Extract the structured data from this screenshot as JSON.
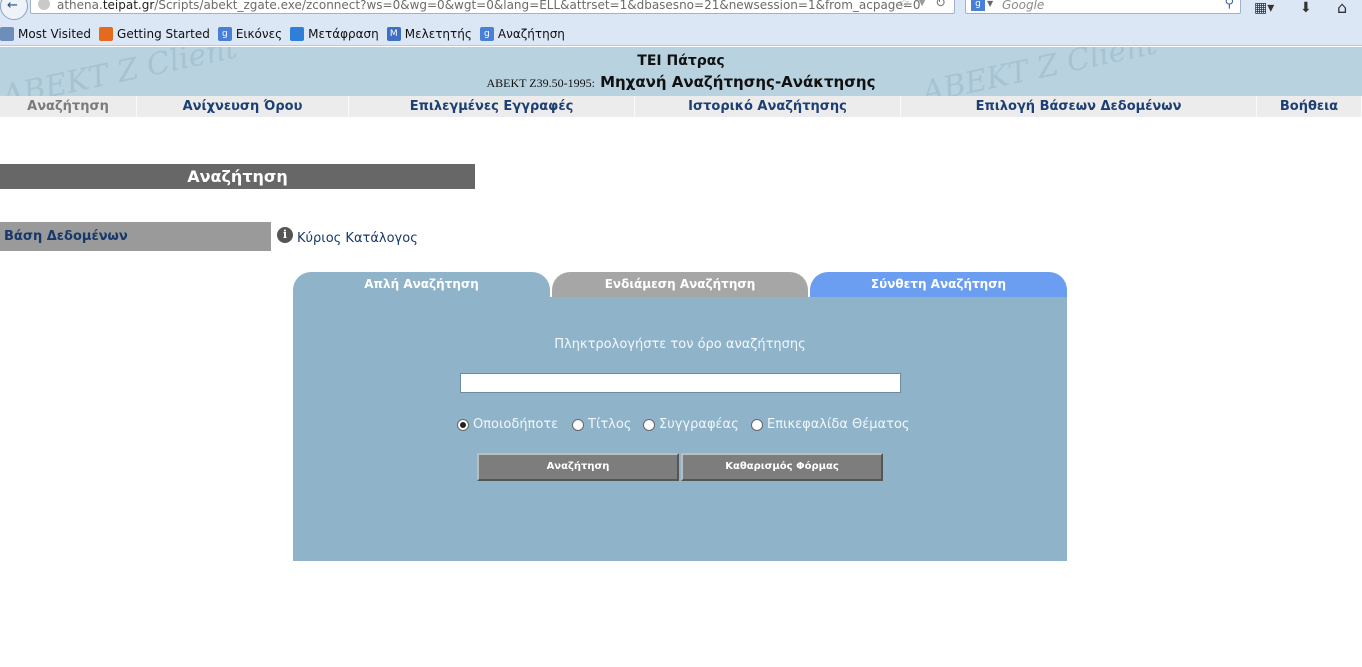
{
  "browser": {
    "url_prefix": "athena.",
    "url_domain": "teipat.gr",
    "url_rest": "/Scripts/abekt_zgate.exe/zconnect?ws=0&wg=0&wgt=0&lang=ELL&attrset=1&dbasesno=21&newsession=1&from_acpage=0",
    "search_engine_icon": "g-icon",
    "search_placeholder": "Google",
    "bookmarks": [
      {
        "label": "Most Visited",
        "icon": "most-visited-icon"
      },
      {
        "label": "Getting Started",
        "icon": "firefox-icon"
      },
      {
        "label": "Εικόνες",
        "icon": "google-icon"
      },
      {
        "label": "Μετάφραση",
        "icon": "translate-icon"
      },
      {
        "label": "Μελετητής",
        "icon": "scholar-icon"
      },
      {
        "label": "Αναζήτηση",
        "icon": "google-icon"
      }
    ]
  },
  "header": {
    "title": "ΤΕΙ Πάτρας",
    "standard": "ABEKT Z39.50-1995:",
    "engine": "Μηχανή Αναζήτησης-Ανάκτησης",
    "watermark": "ABEKT Z Client"
  },
  "menu": {
    "items": [
      {
        "label": "Αναζήτηση",
        "active": true
      },
      {
        "label": "Ανίχνευση Όρου"
      },
      {
        "label": "Επιλεγμένες Εγγραφές"
      },
      {
        "label": "Ιστορικό Αναζήτησης"
      },
      {
        "label": "Επιλογή Βάσεων Δεδομένων"
      },
      {
        "label": "Βοήθεια"
      }
    ]
  },
  "section": {
    "title": "Αναζήτηση"
  },
  "database": {
    "label": "Βάση Δεδομένων",
    "info_icon": "info-icon",
    "name": "Κύριος Κατάλογος"
  },
  "tabs": [
    {
      "label": "Απλή Αναζήτηση",
      "active": true
    },
    {
      "label": "Ενδιάμεση Αναζήτηση"
    },
    {
      "label": "Σύνθετη Αναζήτηση"
    }
  ],
  "search_form": {
    "prompt": "Πληκτρολογήστε τον όρο αναζήτησης",
    "term_value": "",
    "options": [
      {
        "label": "Οποιοδήποτε",
        "checked": true
      },
      {
        "label": "Τίτλος",
        "checked": false
      },
      {
        "label": "Συγγραφέας",
        "checked": false
      },
      {
        "label": "Επικεφαλίδα Θέματος",
        "checked": false
      }
    ],
    "search_button": "Αναζήτηση",
    "clear_button": "Καθαρισμός Φόρμας"
  },
  "colors": {
    "panel": "#8fb3c9",
    "tab_intermediate": "#a6a6a6",
    "tab_advanced": "#6b9df0",
    "menu_text": "#1d3f73",
    "header_bg": "#b9d2df"
  }
}
